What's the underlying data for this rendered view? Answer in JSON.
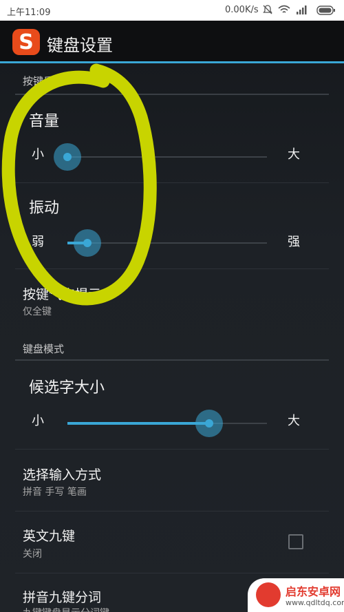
{
  "status_bar": {
    "time": "上午11:09",
    "network_speed": "0.00K/s",
    "icons": [
      "bell-muted-icon",
      "wifi-icon",
      "signal-icon",
      "battery-icon"
    ]
  },
  "app": {
    "logo_letter": "S",
    "title": "键盘设置",
    "accent_color": "#3aa7d6",
    "logo_color": "#e84b1b"
  },
  "sections": {
    "key_feedback": {
      "header": "按键反馈",
      "volume": {
        "title": "音量",
        "min_label": "小",
        "max_label": "大",
        "level": 0.0
      },
      "vibration": {
        "title": "振动",
        "min_label": "弱",
        "max_label": "强",
        "level": 0.1
      },
      "bubble_hint": {
        "title": "按键气泡提示",
        "subtitle": "仅全键"
      }
    },
    "keyboard_mode": {
      "header": "键盘模式",
      "candidate_size": {
        "title": "候选字大小",
        "min_label": "小",
        "max_label": "大",
        "level": 0.71
      },
      "input_method": {
        "title": "选择输入方式",
        "subtitle": "拼音 手写 笔画"
      },
      "english_nine": {
        "title": "英文九键",
        "subtitle": "关闭",
        "checked": false
      },
      "pinyin_nine_split": {
        "title": "拼音九键分词",
        "subtitle": "九键键盘显示分词键"
      }
    }
  },
  "annotation_color": "#c8d400",
  "watermark": {
    "name": "启东安卓网",
    "url": "www.qdltdq.com"
  }
}
